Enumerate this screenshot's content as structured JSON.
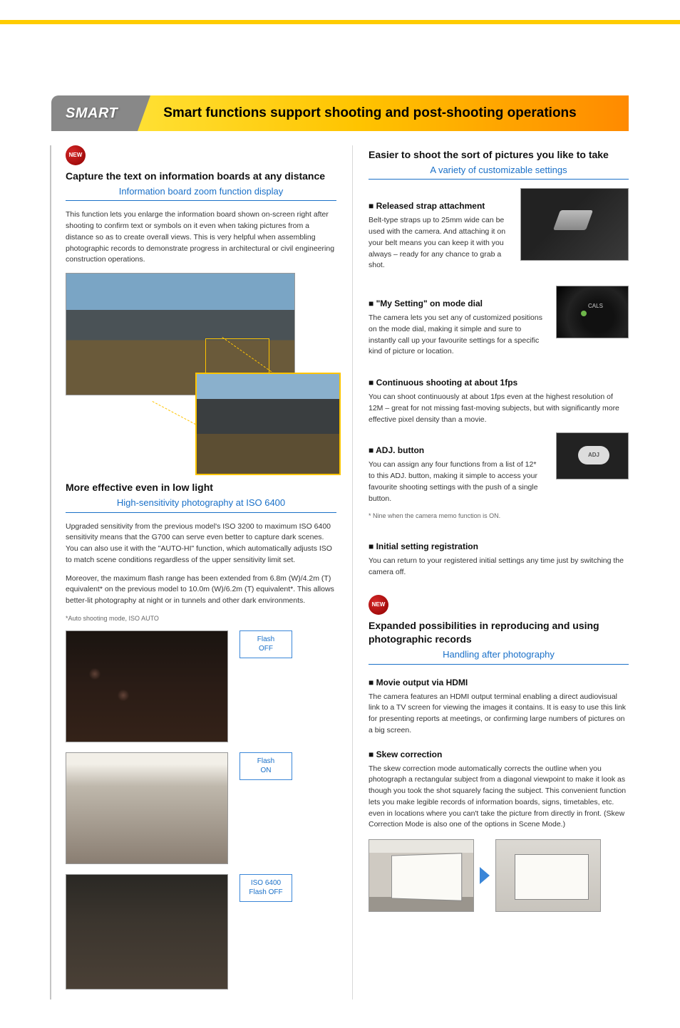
{
  "header": {
    "tab": "SMART",
    "banner": "Smart functions support shooting and post-shooting operations"
  },
  "left": {
    "new_label": "NEW",
    "feature1": {
      "title": "Capture the text on information boards at any distance",
      "subtitle": "Information board zoom function display",
      "body": "This function lets you enlarge the information board shown on-screen right after shooting to confirm text or symbols on it even when taking pictures from a distance so as to create overall views. This is very helpful when assembling photographic records to demonstrate progress in architectural or civil engineering construction operations."
    },
    "feature2": {
      "title": "More effective even in low light",
      "subtitle": "High-sensitivity photography at ISO 6400",
      "body1": "Upgraded sensitivity from the previous model's ISO 3200 to maximum ISO 6400 sensitivity means that the G700 can serve even better to capture dark scenes. You can also use it with the \"AUTO-HI\" function, which automatically adjusts ISO to match scene conditions regardless of the upper sensitivity limit set.",
      "body2": "Moreover, the maximum flash range has been extended from 6.8m (W)/4.2m (T) equivalent* on the previous model to 10.0m (W)/6.2m (T) equivalent*. This allows better-lit photography at night or in tunnels and other dark environments.",
      "note": "*Auto shooting mode, ISO AUTO",
      "samples": [
        {
          "label": "Flash\nOFF"
        },
        {
          "label": "Flash\nON"
        },
        {
          "label": "ISO 6400\nFlash OFF"
        }
      ]
    }
  },
  "right": {
    "feature3": {
      "title": "Easier to shoot the sort of pictures you like to take",
      "subtitle": "A variety of customizable settings",
      "sub1_head": "■ Released strap attachment",
      "sub1_body": "Belt-type straps up to 25mm wide can be used with the camera. And attaching it on your belt means you can keep it with you always – ready for any chance to grab a shot.",
      "sub2_head": "■ \"My Setting\" on mode dial",
      "sub2_body": "The camera lets you set any of customized positions on the mode dial, making it simple and sure to instantly call up your favourite settings for a specific kind of picture or location.",
      "sub3_head": "■ Continuous shooting at about 1fps",
      "sub3_body": "You can shoot continuously at about 1fps even at the highest resolution of 12M – great for not missing fast-moving subjects, but with significantly more effective pixel density than a movie.",
      "sub4_head": "■ ADJ. button",
      "sub4_body": "You can assign any four functions from a list of 12* to this ADJ. button, making it simple to access your favourite shooting settings with the push of a single button.",
      "sub4_note": "* Nine when the camera memo function is ON.",
      "sub5_head": "■ Initial setting registration",
      "sub5_body": "You can return to your registered initial settings any time just by switching the camera off."
    },
    "new_label": "NEW",
    "feature4": {
      "title": "Expanded possibilities in reproducing and using photographic records",
      "subtitle": "Handling after photography",
      "sub1_head": "■ Movie output via HDMI",
      "sub1_body": "The camera features an HDMI output terminal enabling a direct audiovisual link to a TV screen for viewing the images it contains. It is easy to use this link for presenting reports at meetings, or confirming large numbers of pictures on a big screen.",
      "sub2_head": "■ Skew correction",
      "sub2_body": "The skew correction mode automatically corrects the outline when you photograph a rectangular subject from a diagonal viewpoint to make it look as though you took the shot squarely facing the subject. This convenient function lets you make legible records of information boards, signs, timetables, etc. even in locations where you can't take the picture from directly in front. (Skew Correction Mode is also one of the options in Scene Mode.)"
    }
  }
}
